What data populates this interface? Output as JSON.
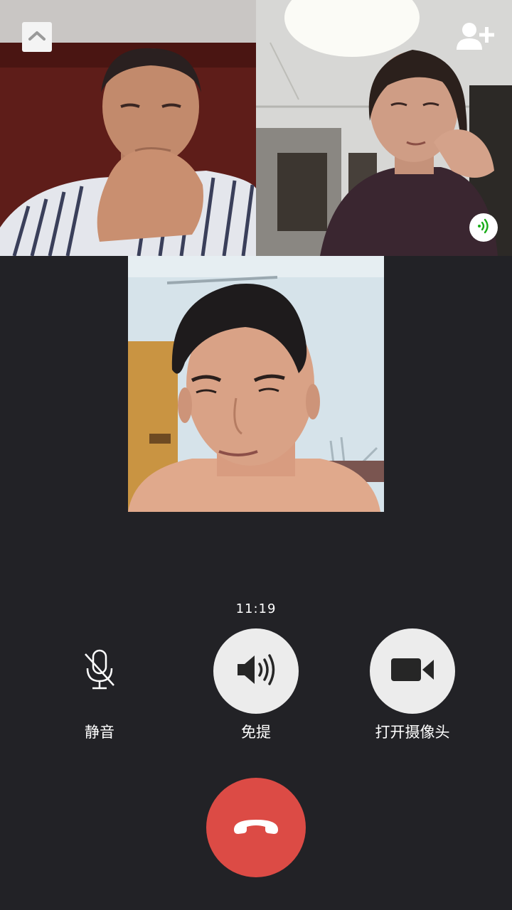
{
  "call": {
    "duration": "11:19"
  },
  "participants": [
    {
      "id": "participant-1",
      "speaking": false
    },
    {
      "id": "participant-2",
      "speaking": true
    },
    {
      "id": "participant-self",
      "speaking": false
    }
  ],
  "top_bar": {
    "minimize_icon": "chevron-up-icon",
    "add_member_icon": "add-person-icon"
  },
  "controls": {
    "mute": {
      "label": "静音",
      "icon": "mic-off-icon",
      "active": false
    },
    "speaker": {
      "label": "免提",
      "icon": "speaker-icon",
      "active": true
    },
    "camera": {
      "label": "打开摄像头",
      "icon": "video-camera-icon",
      "active": true
    }
  },
  "hangup": {
    "icon": "phone-hangup-icon"
  },
  "colors": {
    "background": "#222226",
    "hangup": "#dc4b45",
    "button_fill": "#ececec",
    "speaking_indicator": "#1aad19"
  }
}
